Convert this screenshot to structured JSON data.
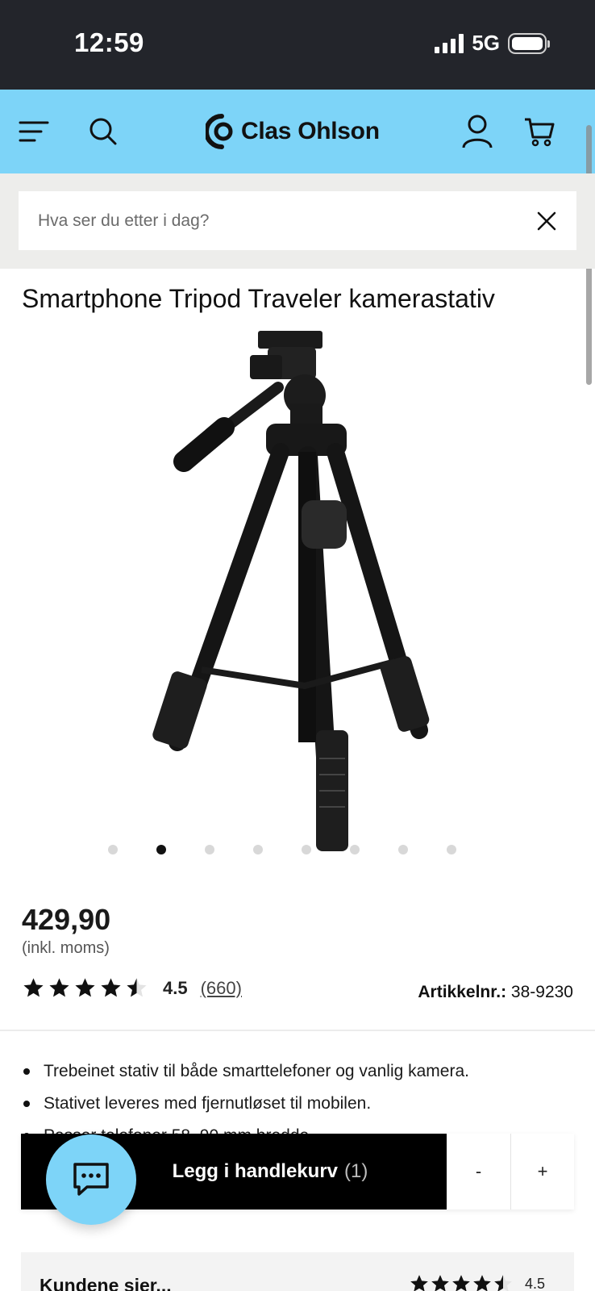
{
  "status_bar": {
    "time": "12:59",
    "network": "5G"
  },
  "header": {
    "brand": "Clas Ohlson",
    "icons": [
      "menu-icon",
      "search-icon",
      "clas-ohlson-logo-icon",
      "account-icon",
      "cart-icon"
    ],
    "background_color": "#7dd4f8"
  },
  "search": {
    "placeholder": "Hva ser du etter i dag?"
  },
  "product": {
    "title": "Smartphone Tripod Traveler kamerastativ",
    "image_count": 8,
    "active_image_index": 1,
    "price": "429,90",
    "vat_note": "(inkl. moms)",
    "rating": {
      "value": "4.5",
      "count": "(660)",
      "stars": 4.5
    },
    "article_label": "Artikkelnr.:",
    "article_number": "38-9230",
    "features": [
      "Trebeinet stativ til både smarttelefoner og vanlig kamera.",
      "Stativet leveres med fjernutløset til mobilen.",
      "Passer telefoner 58–90 mm bredde."
    ]
  },
  "cart_bar": {
    "add_label": "Legg i handlekurv",
    "quantity": "(1)",
    "minus_label": "-",
    "plus_label": "+"
  },
  "reviews": {
    "title": "Kundene sier...",
    "value": "4.5"
  }
}
